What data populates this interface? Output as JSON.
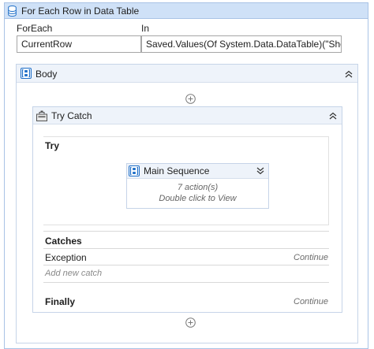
{
  "activity": {
    "title": "For Each Row in Data Table",
    "foreach_label": "ForEach",
    "foreach_value": "CurrentRow",
    "in_label": "In",
    "in_value": "Saved.Values(Of System.Data.DataTable)(\"Sheet_Da"
  },
  "body": {
    "title": "Body",
    "collapse_icon": "double-chevron-up-icon",
    "add_icon": "add-circle-icon"
  },
  "try_catch": {
    "title": "Try Catch",
    "try_label": "Try",
    "main_sequence": {
      "title": "Main Sequence",
      "actions_text": "7 action(s)",
      "hint_text": "Double click to View"
    },
    "catches_label": "Catches",
    "catches": [
      {
        "exception": "Exception",
        "action": "Continue"
      }
    ],
    "add_catch_text": "Add new catch",
    "finally_label": "Finally",
    "finally_action": "Continue"
  },
  "colors": {
    "header_blue": "#cfe1f7",
    "panel_border": "#c6d4e8",
    "icon_blue": "#1f6fc8"
  }
}
